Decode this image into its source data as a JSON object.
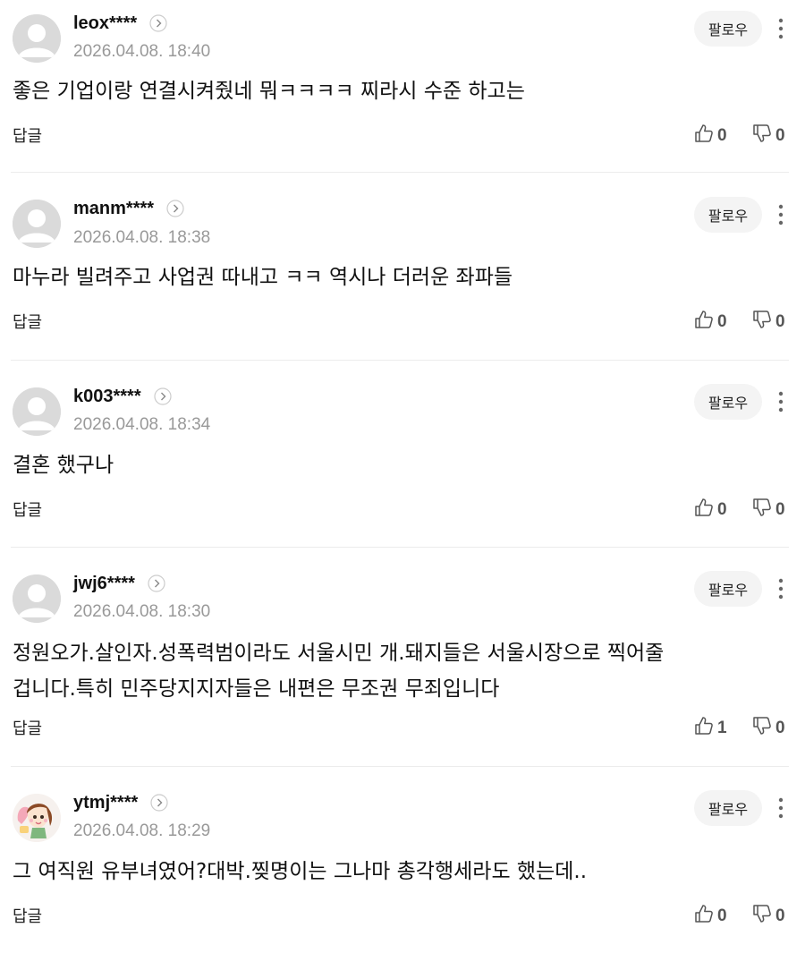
{
  "comments": [
    {
      "username": "leox****",
      "timestamp": "2026.04.08. 18:40",
      "text": "좋은 기업이랑 연결시켜줬네 뭐ㅋㅋㅋㅋ 찌라시 수준 하고는",
      "reply_label": "답글",
      "follow_label": "팔로우",
      "likes": "0",
      "dislikes": "0",
      "avatar": "default-avatar-icon"
    },
    {
      "username": "manm****",
      "timestamp": "2026.04.08. 18:38",
      "text": "마누라 빌려주고 사업권 따내고 ㅋㅋ 역시나 더러운 좌파들",
      "reply_label": "답글",
      "follow_label": "팔로우",
      "likes": "0",
      "dislikes": "0",
      "avatar": "default-avatar-icon"
    },
    {
      "username": "k003****",
      "timestamp": "2026.04.08. 18:34",
      "text": "결혼 했구나",
      "reply_label": "답글",
      "follow_label": "팔로우",
      "likes": "0",
      "dislikes": "0",
      "avatar": "default-avatar-icon"
    },
    {
      "username": "jwj6****",
      "timestamp": "2026.04.08. 18:30",
      "text": "정원오가.살인자.성폭력범이라도 서울시민 개.돼지들은 서울시장으로 찍어줄\n겁니다.특히 민주당지지자들은 내편은 무조권 무죄입니다",
      "reply_label": "답글",
      "follow_label": "팔로우",
      "likes": "1",
      "dislikes": "0",
      "avatar": "default-avatar-icon"
    },
    {
      "username": "ytmj****",
      "timestamp": "2026.04.08. 18:29",
      "text": "그 여직원 유부녀였어?대박.찢명이는 그나마 총각행세라도 했는데..",
      "reply_label": "답글",
      "follow_label": "팔로우",
      "likes": "0",
      "dislikes": "0",
      "avatar": "character-avatar-image"
    }
  ],
  "colors": {
    "username": "#111111",
    "timestamp": "#999999",
    "follow_bg": "#f4f4f4",
    "avatar_bg": "#dadada",
    "divider": "#ececec"
  }
}
